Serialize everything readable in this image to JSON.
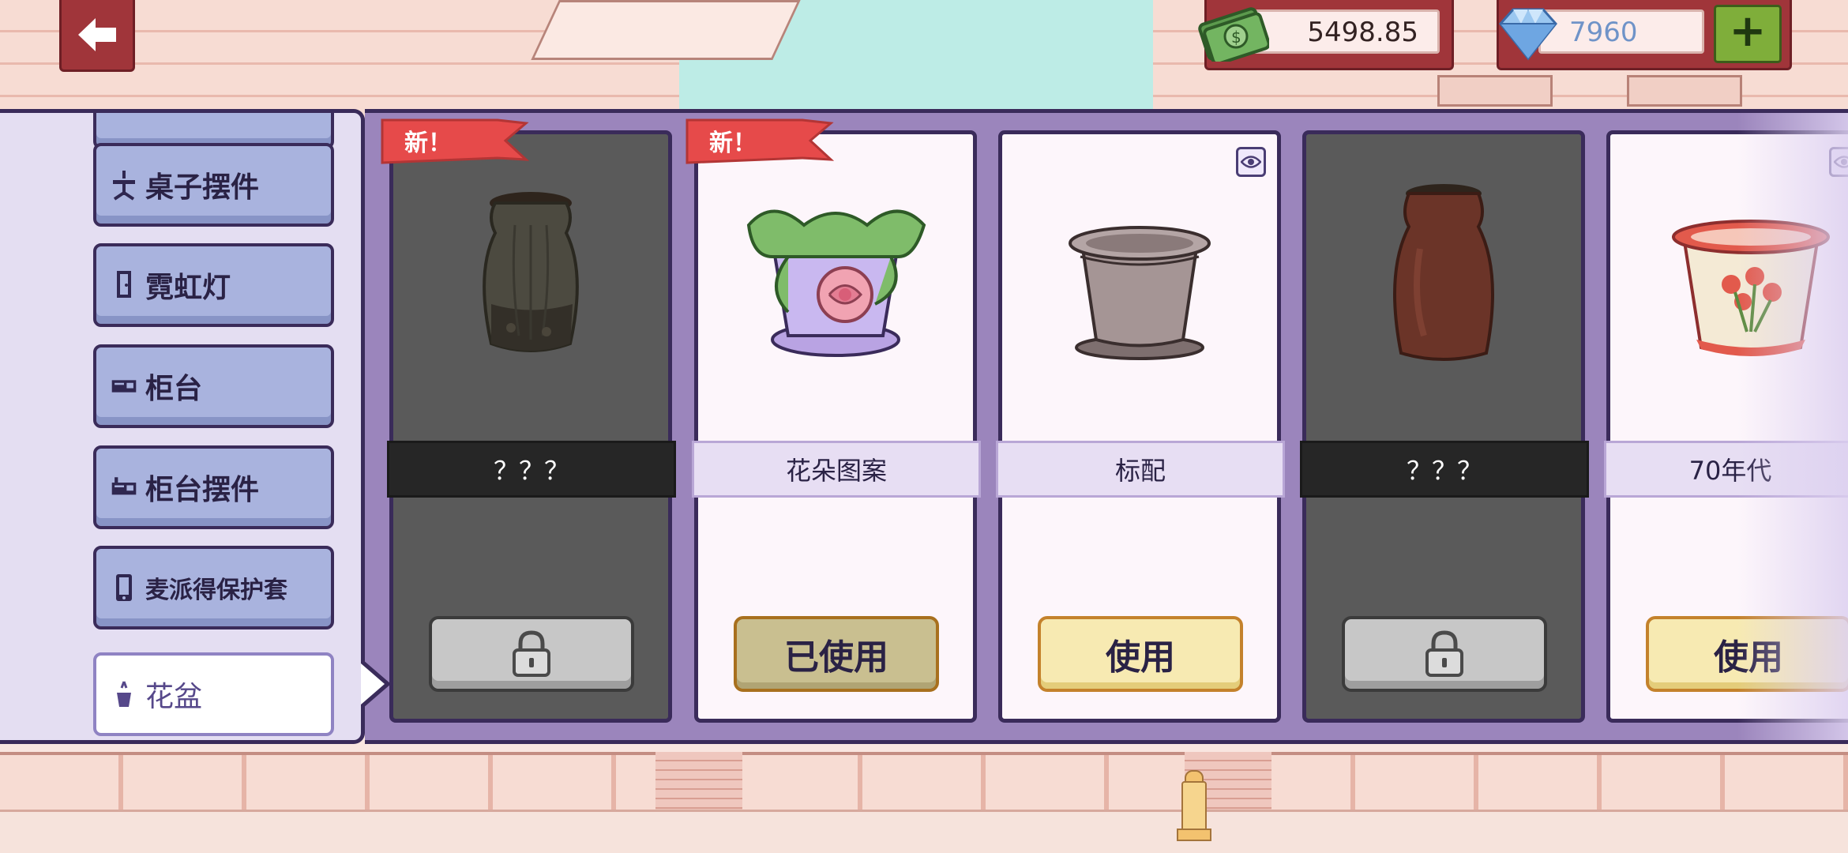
{
  "hud": {
    "back_icon": "back-arrow-icon",
    "cash_value": "5498.85",
    "gems_value": "7960",
    "add_label": "+"
  },
  "categories": [
    {
      "label": "",
      "icon": "top-cut-icon"
    },
    {
      "label": "桌子摆件",
      "icon": "desk-decoration-icon"
    },
    {
      "label": "霓虹灯",
      "icon": "door-icon"
    },
    {
      "label": "柜台",
      "icon": "counter-icon"
    },
    {
      "label": "柜台摆件",
      "icon": "counter-decoration-icon"
    },
    {
      "label": "麦派得保护套",
      "icon": "tablet-icon"
    },
    {
      "label": "花盆",
      "icon": "flowerpot-icon",
      "active": true
    }
  ],
  "cards": [
    {
      "name": "？？？",
      "state": "locked",
      "new": true,
      "ribbon": "新！"
    },
    {
      "name": "花朵图案",
      "state": "used",
      "new": true,
      "ribbon": "新！",
      "action": "已使用"
    },
    {
      "name": "标配",
      "state": "available",
      "action": "使用",
      "preview": "eye-icon"
    },
    {
      "name": "？？？",
      "state": "locked"
    },
    {
      "name": "70年代",
      "state": "available",
      "action": "使用",
      "preview": "eye-icon"
    }
  ],
  "colors": {
    "panel_border": "#3a2b5a",
    "panel_purple": "#9b85bc",
    "category_button": "#a9b3de",
    "ribbon_red": "#e64a4a",
    "use_button": "#f7eab2"
  }
}
